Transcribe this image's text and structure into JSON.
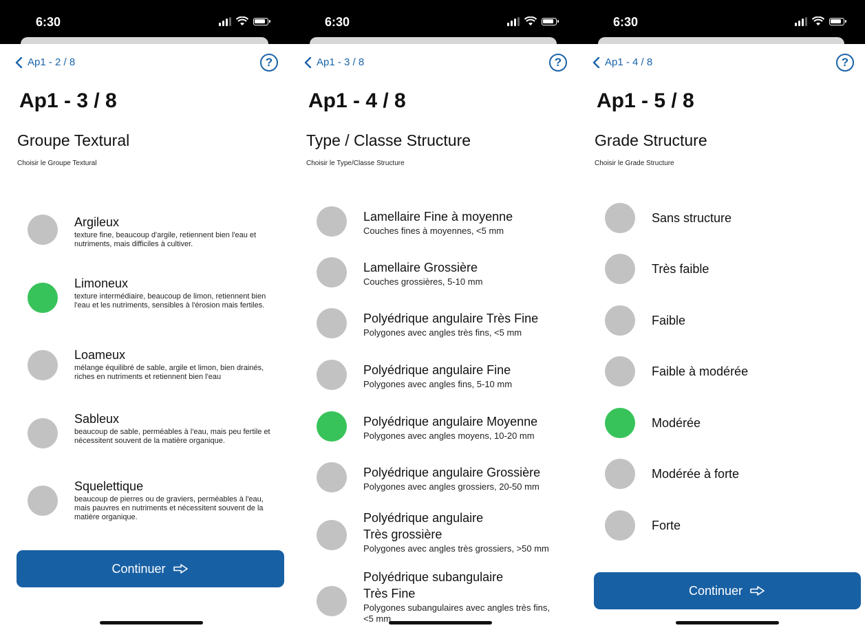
{
  "status": {
    "time": "6:30"
  },
  "screens": [
    {
      "back": "Ap1 - 2 / 8",
      "help": "?",
      "title": "Ap1 - 3 / 8",
      "heading": "Groupe Textural",
      "subtitle": "Choisir le Groupe Textural",
      "options": [
        {
          "title": "Argileux",
          "desc": "texture fine, beaucoup d'argile, retiennent bien l'eau et nutriments, mais difficiles à cultiver.",
          "selected": false
        },
        {
          "title": "Limoneux",
          "desc": "texture intermédiaire, beaucoup de limon, retiennent bien l'eau et les nutriments, sensibles à l'érosion mais fertiles.",
          "selected": true
        },
        {
          "title": "Loameux",
          "desc": "mélange équilibré de sable, argile et limon, bien drainés, riches en nutriments et retiennent bien l'eau",
          "selected": false
        },
        {
          "title": "Sableux",
          "desc": "beaucoup de sable, perméables à l'eau, mais peu fertile et nécessitent souvent de la matière organique.",
          "selected": false
        },
        {
          "title": "Squelettique",
          "desc": "beaucoup de pierres ou de graviers, perméables à l'eau, mais pauvres en nutriments et nécessitent souvent de la matière organique.",
          "selected": false
        }
      ],
      "continue": "Continuer"
    },
    {
      "back": "Ap1 - 3 / 8",
      "help": "?",
      "title": "Ap1 - 4 / 8",
      "heading": "Type / Classe Structure",
      "subtitle": "Choisir le Type/Classe Structure",
      "options": [
        {
          "title": "Lamellaire Fine à moyenne",
          "desc": "Couches fines à moyennes, <5 mm",
          "selected": false
        },
        {
          "title": "Lamellaire Grossière",
          "desc": "Couches grossières, 5-10 mm",
          "selected": false
        },
        {
          "title": "Polyédrique angulaire Très Fine",
          "desc": "Polygones avec angles très fins, <5 mm",
          "selected": false
        },
        {
          "title": "Polyédrique angulaire Fine",
          "desc": "Polygones avec angles fins, 5-10 mm",
          "selected": false
        },
        {
          "title": "Polyédrique angulaire Moyenne",
          "desc": "Polygones avec angles moyens, 10-20 mm",
          "selected": true
        },
        {
          "title": "Polyédrique angulaire Grossière",
          "desc": "Polygones avec angles grossiers, 20-50 mm",
          "selected": false
        },
        {
          "title": "Polyédrique angulaire",
          "title2": "Très grossière",
          "desc": "Polygones avec angles très grossiers, >50 mm",
          "selected": false
        },
        {
          "title": "Polyédrique subangulaire",
          "title2": "Très Fine",
          "desc": "Polygones subangulaires avec angles très fins,",
          "desc2": "<5 mm",
          "selected": false
        }
      ]
    },
    {
      "back": "Ap1 - 4 / 8",
      "help": "?",
      "title": "Ap1 - 5 / 8",
      "heading": "Grade Structure",
      "subtitle": "Choisir le Grade Structure",
      "options": [
        {
          "title": "Sans structure",
          "selected": false
        },
        {
          "title": "Très faible",
          "selected": false
        },
        {
          "title": "Faible",
          "selected": false
        },
        {
          "title": "Faible à modérée",
          "selected": false
        },
        {
          "title": "Modérée",
          "selected": true
        },
        {
          "title": "Modérée à forte",
          "selected": false
        },
        {
          "title": "Forte",
          "selected": false
        }
      ],
      "continue": "Continuer"
    }
  ]
}
